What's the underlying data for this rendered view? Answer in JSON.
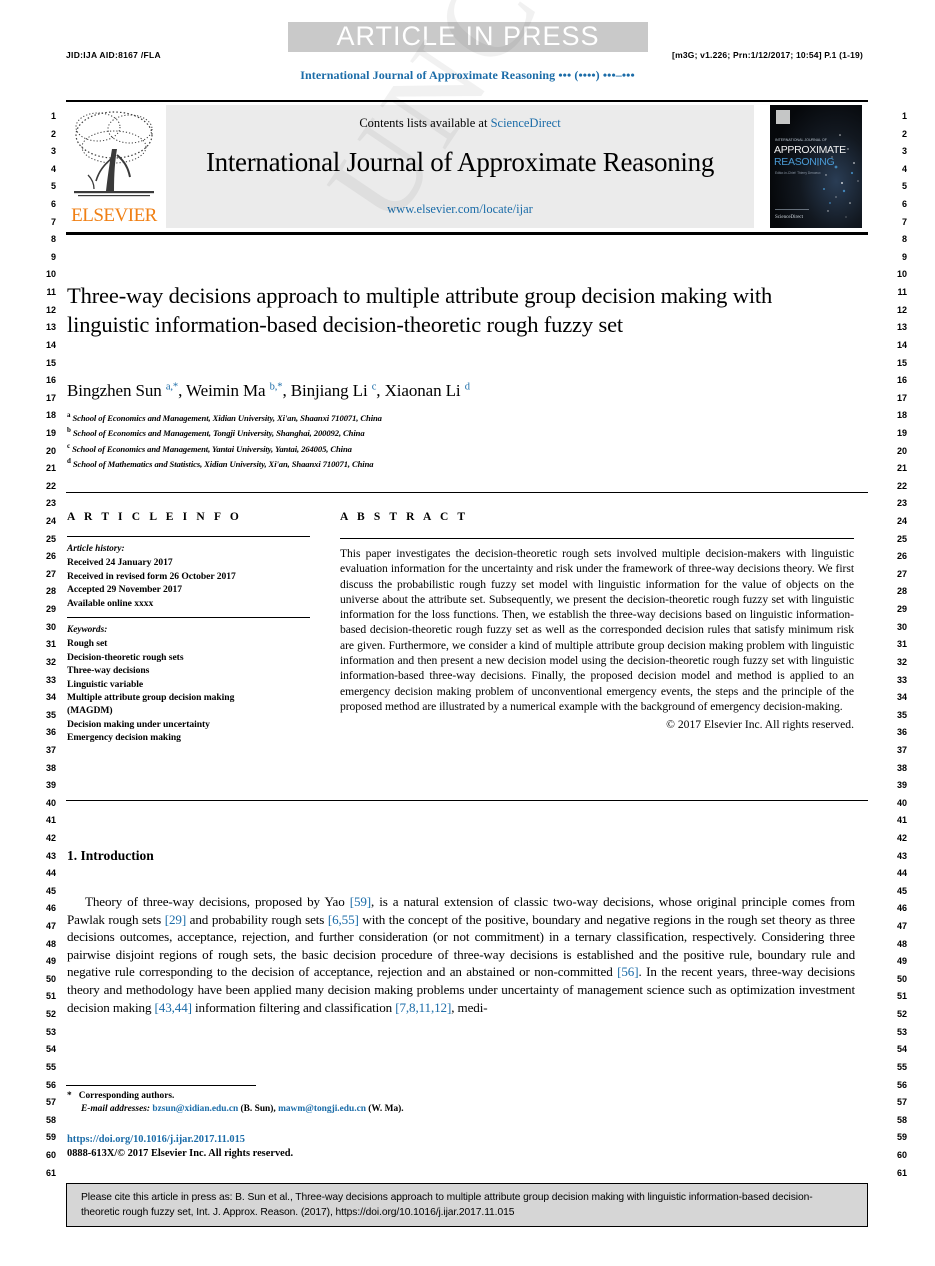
{
  "banner": {
    "press_label": "ARTICLE IN PRESS"
  },
  "header": {
    "jid": "JID:IJA    AID:8167 /FLA",
    "prn_meta": "[m3G; v1.226; Prn:1/12/2017; 10:54] P.1 (1-19)",
    "running_title": "International Journal of Approximate Reasoning ••• (••••) •••–•••"
  },
  "masthead": {
    "contents_prefix": "Contents lists available at ",
    "sciencedirect": "ScienceDirect",
    "journal_name": "International Journal of Approximate Reasoning",
    "journal_url": "www.elsevier.com/locate/ijar",
    "publisher": "ELSEVIER",
    "cover_title_1": "APPROXIMATE",
    "cover_title_2": "REASONING"
  },
  "article": {
    "title": "Three-way decisions approach to multiple attribute group decision making with linguistic information-based decision-theoretic rough fuzzy set",
    "authors_html": "Bingzhen Sun <sup>a,*</sup>, Weimin Ma <sup>b,*</sup>, Binjiang Li <sup>c</sup>, Xiaonan Li <sup>d</sup>",
    "affiliations": [
      {
        "marker": "a",
        "text": "School of Economics and Management, Xidian University, Xi'an, Shaanxi 710071, China"
      },
      {
        "marker": "b",
        "text": "School of Economics and Management, Tongji University, Shanghai, 200092, China"
      },
      {
        "marker": "c",
        "text": "School of Economics and Management, Yantai University, Yantai, 264005, China"
      },
      {
        "marker": "d",
        "text": "School of Mathematics and Statistics, Xidian University, Xi'an, Shaanxi 710071, China"
      }
    ]
  },
  "info": {
    "heading": "A R T I C L E    I N F O",
    "history_label": "Article history:",
    "history": [
      "Received 24 January 2017",
      "Received in revised form 26 October 2017",
      "Accepted 29 November 2017",
      "Available online xxxx"
    ],
    "keywords_label": "Keywords:",
    "keywords": [
      "Rough set",
      "Decision-theoretic rough sets",
      "Three-way decisions",
      "Linguistic variable",
      "Multiple attribute group decision making",
      "(MAGDM)",
      "Decision making under uncertainty",
      "Emergency decision making"
    ]
  },
  "abstract": {
    "heading": "A B S T R A C T",
    "body": "This paper investigates the decision-theoretic rough sets involved multiple decision-makers with linguistic evaluation information for the uncertainty and risk under the framework of three-way decisions theory. We first discuss the probabilistic rough fuzzy set model with linguistic information for the value of objects on the universe about the attribute set. Subsequently, we present the decision-theoretic rough fuzzy set with linguistic information for the loss functions. Then, we establish the three-way decisions based on linguistic information-based decision-theoretic rough fuzzy set as well as the corresponded decision rules that satisfy minimum risk are given. Furthermore, we consider a kind of multiple attribute group decision making problem with linguistic information and then present a new decision model using the decision-theoretic rough fuzzy set with linguistic information-based three-way decisions. Finally, the proposed decision model and method is applied to an emergency decision making problem of unconventional emergency events, the steps and the principle of the proposed method are illustrated by a numerical example with the background of emergency decision-making.",
    "copyright": "© 2017 Elsevier Inc. All rights reserved."
  },
  "introduction": {
    "heading": "1. Introduction",
    "paragraph_html": "Theory of three-way decisions, proposed by Yao <span class=\"cite\">[59]</span>, is a natural extension of classic two-way decisions, whose original principle comes from Pawlak rough sets <span class=\"cite\">[29]</span> and probability rough sets <span class=\"cite\">[6,55]</span> with the concept of the positive, boundary and negative regions in the rough set theory as three decisions outcomes, acceptance, rejection, and further consideration (or not commitment) in a ternary classification, respectively. Considering three pairwise disjoint regions of rough sets, the basic decision procedure of three-way decisions is established and the positive rule, boundary rule and negative rule corresponding to the decision of acceptance, rejection and an abstained or non-committed <span class=\"cite\">[56]</span>. In the recent years, three-way decisions theory and methodology have been applied many decision making problems under uncertainty of management science such as optimization investment decision making <span class=\"cite\">[43,44]</span> information filtering and classification <span class=\"cite\">[7,8,11,12]</span>, medi-"
  },
  "footnote": {
    "corresponding": "Corresponding authors.",
    "email_label": "E-mail addresses:",
    "email_1": "bzsun@xidian.edu.cn",
    "email_1_who": "(B. Sun),",
    "email_2": "mawm@tongji.edu.cn",
    "email_2_who": "(W. Ma).",
    "doi": "https://doi.org/10.1016/j.ijar.2017.11.015",
    "issn_line": "0888-613X/© 2017 Elsevier Inc. All rights reserved."
  },
  "cite_box": {
    "text": "Please cite this article in press as: B. Sun et al., Three-way decisions approach to multiple attribute group decision making with linguistic information-based decision-theoretic rough fuzzy set, Int. J. Approx. Reason. (2017), https://doi.org/10.1016/j.ijar.2017.11.015"
  },
  "watermark": {
    "text": "UNCORRECTED PROOF"
  },
  "colors": {
    "link": "#1b6ca8",
    "elsevier_orange": "#f07f13",
    "banner_gray": "#c9c9c9",
    "box_gray": "#ebebeb",
    "cite_box_gray": "#d6d6d6"
  },
  "line_numbers": {
    "start": 1,
    "end": 61
  }
}
